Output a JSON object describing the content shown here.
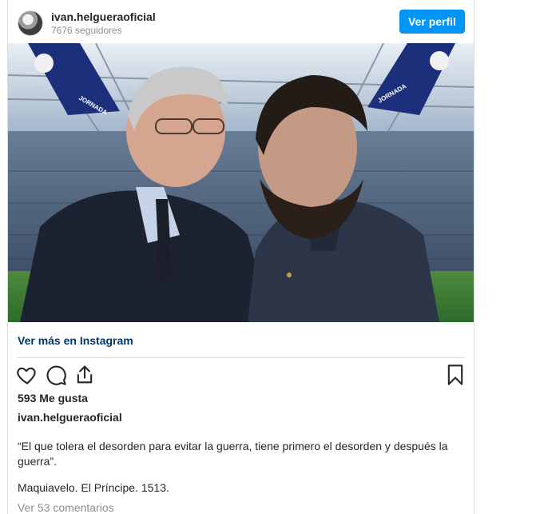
{
  "post": {
    "username": "ivan.helgueraoficial",
    "followers": "7676 seguidores",
    "follow_label": "Ver perfil",
    "view_more": "Ver más en Instagram",
    "likes": "593 Me gusta",
    "caption_user": "ivan.helgueraoficial",
    "quote": "“El que tolera el desorden para evitar la guerra, tiene primero el desorden y después la guerra”.",
    "source": "Maquiavelo. El Príncipe. 1513.",
    "comments": "Ver 53 comentarios"
  },
  "photo": {
    "banner_text": "JORNADA"
  },
  "icons": {
    "like": "heart-icon",
    "comment": "comment-icon",
    "share": "share-icon",
    "save": "bookmark-icon"
  },
  "colors": {
    "accent": "#0095f6",
    "link": "#00376b",
    "muted": "#8e8e8e"
  }
}
